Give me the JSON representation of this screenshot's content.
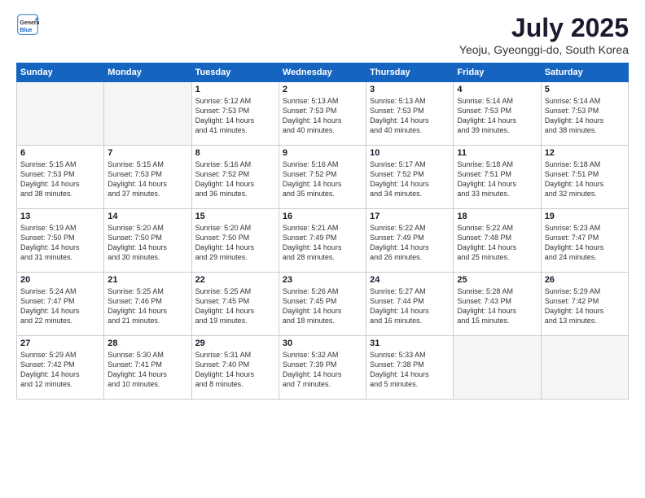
{
  "logo": {
    "general": "General",
    "blue": "Blue"
  },
  "title": "July 2025",
  "subtitle": "Yeoju, Gyeonggi-do, South Korea",
  "headers": [
    "Sunday",
    "Monday",
    "Tuesday",
    "Wednesday",
    "Thursday",
    "Friday",
    "Saturday"
  ],
  "weeks": [
    [
      {
        "day": "",
        "info": ""
      },
      {
        "day": "",
        "info": ""
      },
      {
        "day": "1",
        "info": "Sunrise: 5:12 AM\nSunset: 7:53 PM\nDaylight: 14 hours\nand 41 minutes."
      },
      {
        "day": "2",
        "info": "Sunrise: 5:13 AM\nSunset: 7:53 PM\nDaylight: 14 hours\nand 40 minutes."
      },
      {
        "day": "3",
        "info": "Sunrise: 5:13 AM\nSunset: 7:53 PM\nDaylight: 14 hours\nand 40 minutes."
      },
      {
        "day": "4",
        "info": "Sunrise: 5:14 AM\nSunset: 7:53 PM\nDaylight: 14 hours\nand 39 minutes."
      },
      {
        "day": "5",
        "info": "Sunrise: 5:14 AM\nSunset: 7:53 PM\nDaylight: 14 hours\nand 38 minutes."
      }
    ],
    [
      {
        "day": "6",
        "info": "Sunrise: 5:15 AM\nSunset: 7:53 PM\nDaylight: 14 hours\nand 38 minutes."
      },
      {
        "day": "7",
        "info": "Sunrise: 5:15 AM\nSunset: 7:53 PM\nDaylight: 14 hours\nand 37 minutes."
      },
      {
        "day": "8",
        "info": "Sunrise: 5:16 AM\nSunset: 7:52 PM\nDaylight: 14 hours\nand 36 minutes."
      },
      {
        "day": "9",
        "info": "Sunrise: 5:16 AM\nSunset: 7:52 PM\nDaylight: 14 hours\nand 35 minutes."
      },
      {
        "day": "10",
        "info": "Sunrise: 5:17 AM\nSunset: 7:52 PM\nDaylight: 14 hours\nand 34 minutes."
      },
      {
        "day": "11",
        "info": "Sunrise: 5:18 AM\nSunset: 7:51 PM\nDaylight: 14 hours\nand 33 minutes."
      },
      {
        "day": "12",
        "info": "Sunrise: 5:18 AM\nSunset: 7:51 PM\nDaylight: 14 hours\nand 32 minutes."
      }
    ],
    [
      {
        "day": "13",
        "info": "Sunrise: 5:19 AM\nSunset: 7:50 PM\nDaylight: 14 hours\nand 31 minutes."
      },
      {
        "day": "14",
        "info": "Sunrise: 5:20 AM\nSunset: 7:50 PM\nDaylight: 14 hours\nand 30 minutes."
      },
      {
        "day": "15",
        "info": "Sunrise: 5:20 AM\nSunset: 7:50 PM\nDaylight: 14 hours\nand 29 minutes."
      },
      {
        "day": "16",
        "info": "Sunrise: 5:21 AM\nSunset: 7:49 PM\nDaylight: 14 hours\nand 28 minutes."
      },
      {
        "day": "17",
        "info": "Sunrise: 5:22 AM\nSunset: 7:49 PM\nDaylight: 14 hours\nand 26 minutes."
      },
      {
        "day": "18",
        "info": "Sunrise: 5:22 AM\nSunset: 7:48 PM\nDaylight: 14 hours\nand 25 minutes."
      },
      {
        "day": "19",
        "info": "Sunrise: 5:23 AM\nSunset: 7:47 PM\nDaylight: 14 hours\nand 24 minutes."
      }
    ],
    [
      {
        "day": "20",
        "info": "Sunrise: 5:24 AM\nSunset: 7:47 PM\nDaylight: 14 hours\nand 22 minutes."
      },
      {
        "day": "21",
        "info": "Sunrise: 5:25 AM\nSunset: 7:46 PM\nDaylight: 14 hours\nand 21 minutes."
      },
      {
        "day": "22",
        "info": "Sunrise: 5:25 AM\nSunset: 7:45 PM\nDaylight: 14 hours\nand 19 minutes."
      },
      {
        "day": "23",
        "info": "Sunrise: 5:26 AM\nSunset: 7:45 PM\nDaylight: 14 hours\nand 18 minutes."
      },
      {
        "day": "24",
        "info": "Sunrise: 5:27 AM\nSunset: 7:44 PM\nDaylight: 14 hours\nand 16 minutes."
      },
      {
        "day": "25",
        "info": "Sunrise: 5:28 AM\nSunset: 7:43 PM\nDaylight: 14 hours\nand 15 minutes."
      },
      {
        "day": "26",
        "info": "Sunrise: 5:29 AM\nSunset: 7:42 PM\nDaylight: 14 hours\nand 13 minutes."
      }
    ],
    [
      {
        "day": "27",
        "info": "Sunrise: 5:29 AM\nSunset: 7:42 PM\nDaylight: 14 hours\nand 12 minutes."
      },
      {
        "day": "28",
        "info": "Sunrise: 5:30 AM\nSunset: 7:41 PM\nDaylight: 14 hours\nand 10 minutes."
      },
      {
        "day": "29",
        "info": "Sunrise: 5:31 AM\nSunset: 7:40 PM\nDaylight: 14 hours\nand 8 minutes."
      },
      {
        "day": "30",
        "info": "Sunrise: 5:32 AM\nSunset: 7:39 PM\nDaylight: 14 hours\nand 7 minutes."
      },
      {
        "day": "31",
        "info": "Sunrise: 5:33 AM\nSunset: 7:38 PM\nDaylight: 14 hours\nand 5 minutes."
      },
      {
        "day": "",
        "info": ""
      },
      {
        "day": "",
        "info": ""
      }
    ]
  ]
}
